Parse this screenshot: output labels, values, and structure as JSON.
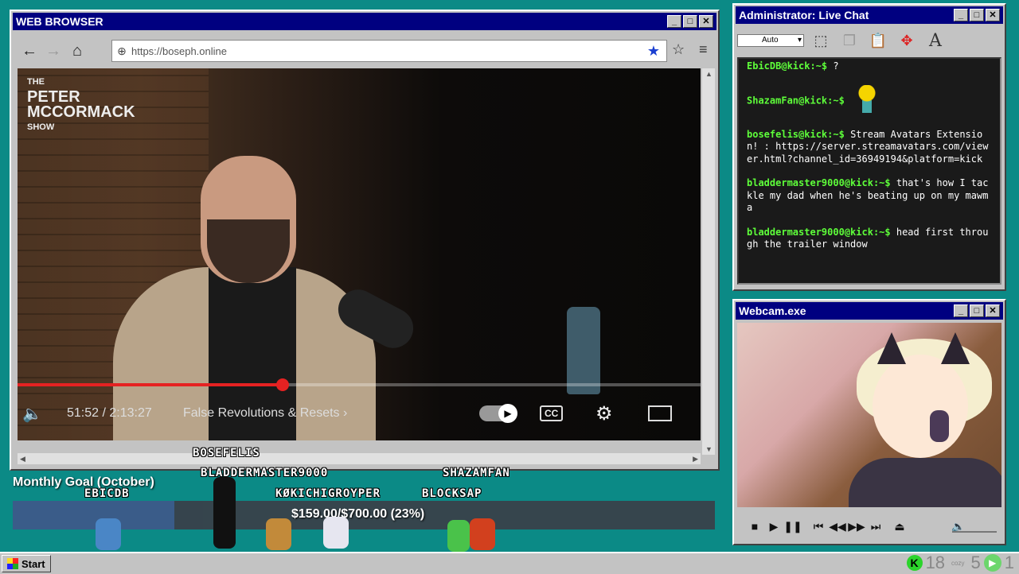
{
  "browser": {
    "title": "WEB BROWSER",
    "url": "https://boseph.online",
    "video": {
      "watermark_line1": "THE",
      "watermark_line2": "PETER",
      "watermark_line3": "MCCORMACK",
      "watermark_line4": "SHOW",
      "time": "51:52 / 2:13:27",
      "chapter": "False Revolutions & Resets",
      "progress": 0.388,
      "cc_label": "CC",
      "progress_color": "#e52222"
    }
  },
  "chat": {
    "title": "Administrator: Live Chat",
    "select_value": "Auto",
    "tool_text": "A",
    "messages": [
      {
        "user": "EbicDB@kick:~$",
        "text": "?"
      },
      {
        "user": "ShazamFan@kick:~$",
        "text": ""
      },
      {
        "user": "bosefelis@kick:~$",
        "text": "Stream Avatars Extension! : https://server.streamavatars.com/viewer.html?channel_id=36949194&platform=kick"
      },
      {
        "user": "bladdermaster9000@kick:~$",
        "text": "that's how I tackle my dad when he's beating up on my mawma"
      },
      {
        "user": "bladdermaster9000@kick:~$",
        "text": "head first through the trailer window"
      }
    ]
  },
  "webcam": {
    "title": "Webcam.exe"
  },
  "goal": {
    "label": "Monthly Goal (October)",
    "text": "$159.00/$700.00 (23%)",
    "progress": 0.23
  },
  "avatars": [
    "BOSEFELIS",
    "BLADDERMASTER9000",
    "EBICDB",
    "KØKICHIGROYPER",
    "SHAZAMFAN",
    "BLOCKSAP"
  ],
  "taskbar": {
    "start_label": "Start",
    "tray_k": "K",
    "tray_num1": "18",
    "tray_small": "cozy",
    "tray_num2": "5",
    "tray_num3": "1"
  },
  "icons": {
    "back": "arrow-left",
    "forward": "arrow-right",
    "home": "home",
    "bookmark": "star",
    "menu": "hamburger",
    "volume": "speaker",
    "settings": "gear",
    "theater": "rectangle"
  }
}
